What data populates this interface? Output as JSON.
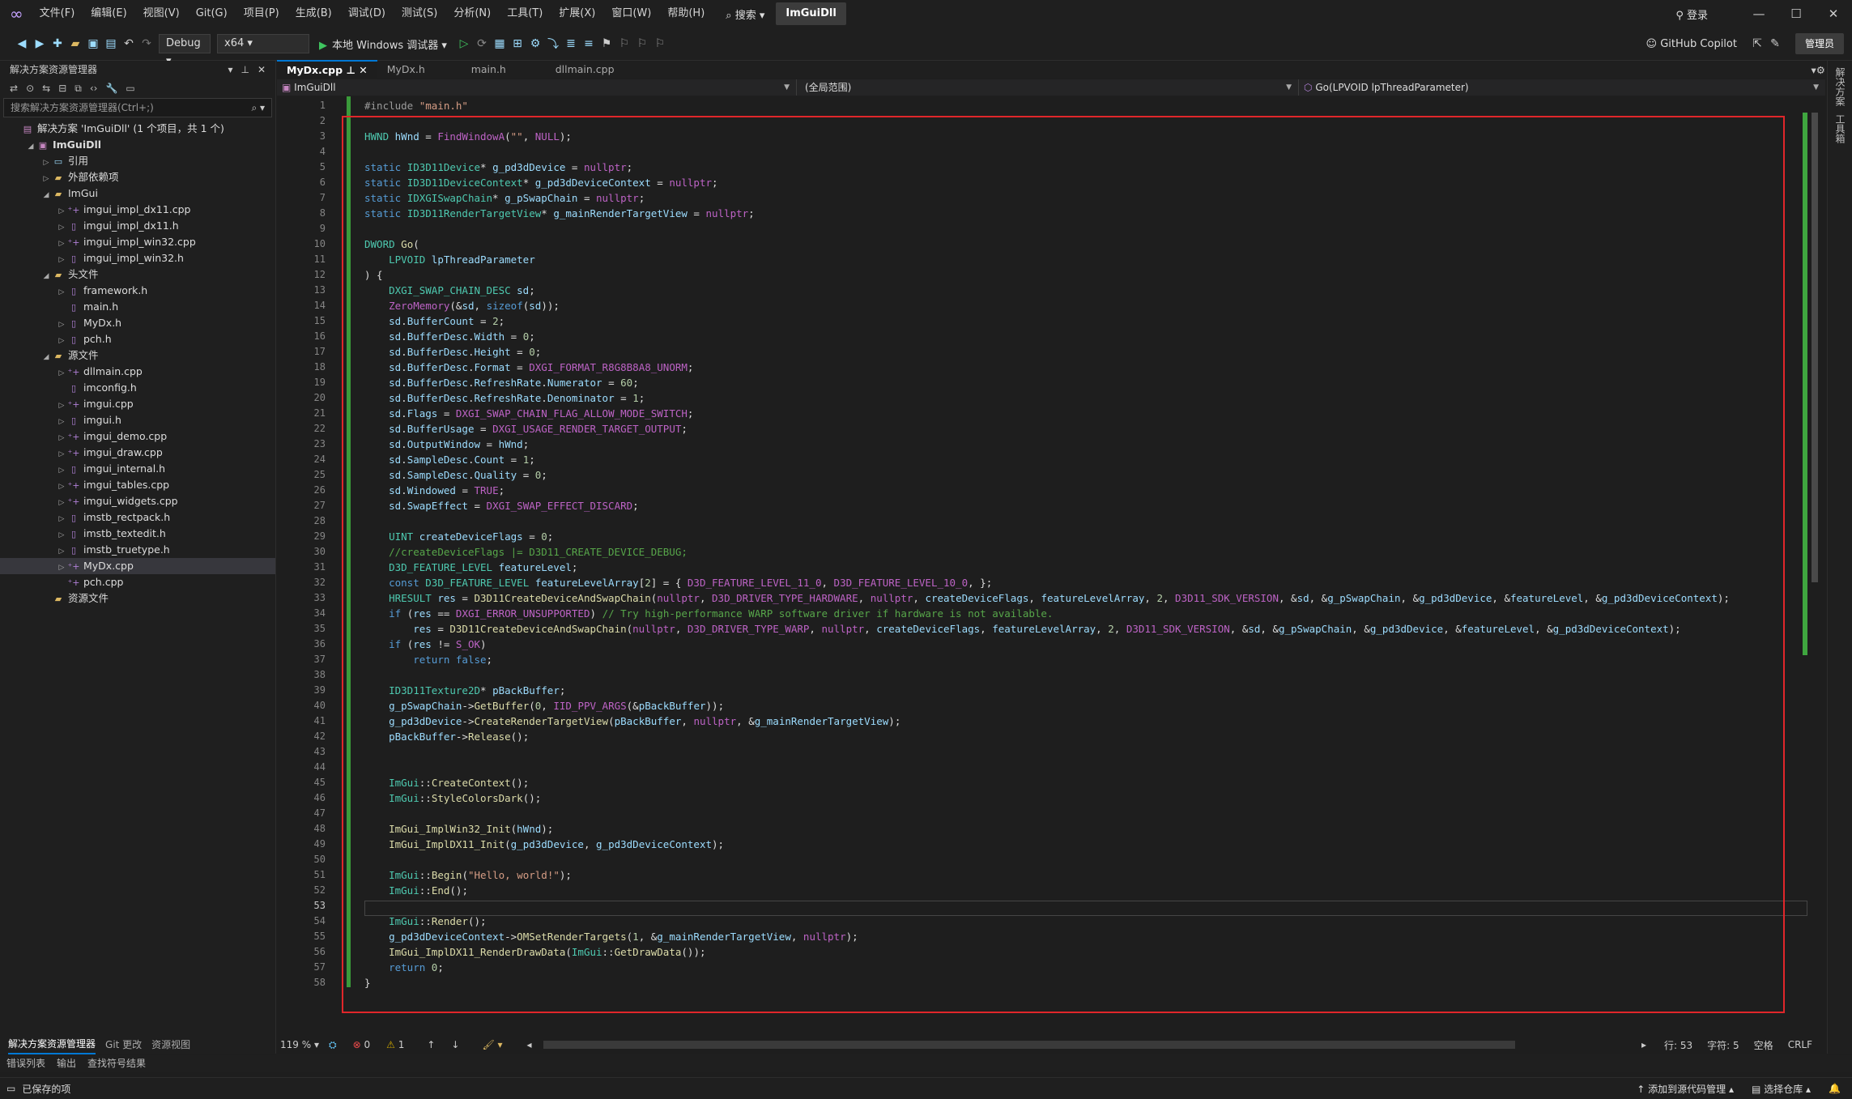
{
  "menubar": {
    "items": [
      "文件(F)",
      "编辑(E)",
      "视图(V)",
      "Git(G)",
      "项目(P)",
      "生成(B)",
      "调试(D)",
      "测试(S)",
      "分析(N)",
      "工具(T)",
      "扩展(X)",
      "窗口(W)",
      "帮助(H)"
    ],
    "search_label": "搜索",
    "app_title": "ImGuiDll",
    "login_label": "登录"
  },
  "toolbar": {
    "config": "Debug",
    "platform": "x64",
    "run_label": "本地 Windows 调试器",
    "copilot_label": "GitHub Copilot",
    "admin_label": "管理员"
  },
  "solution_explorer": {
    "title": "解决方案资源管理器",
    "search_placeholder": "搜索解决方案资源管理器(Ctrl+;)",
    "items": [
      {
        "label": "解决方案 'ImGuiDll' (1 个项目，共 1 个)",
        "indent": 0,
        "icon": "solution",
        "arrow": ""
      },
      {
        "label": "ImGuiDll",
        "indent": 1,
        "icon": "project",
        "arrow": "open",
        "bold": true
      },
      {
        "label": "引用",
        "indent": 2,
        "icon": "references",
        "arrow": "closed"
      },
      {
        "label": "外部依赖项",
        "indent": 2,
        "icon": "folder",
        "arrow": "closed"
      },
      {
        "label": "ImGui",
        "indent": 2,
        "icon": "folder",
        "arrow": "open"
      },
      {
        "label": "imgui_impl_dx11.cpp",
        "indent": 3,
        "icon": "cpp",
        "arrow": "closed"
      },
      {
        "label": "imgui_impl_dx11.h",
        "indent": 3,
        "icon": "h",
        "arrow": "closed"
      },
      {
        "label": "imgui_impl_win32.cpp",
        "indent": 3,
        "icon": "cpp",
        "arrow": "closed"
      },
      {
        "label": "imgui_impl_win32.h",
        "indent": 3,
        "icon": "h",
        "arrow": "closed"
      },
      {
        "label": "头文件",
        "indent": 2,
        "icon": "folder",
        "arrow": "open"
      },
      {
        "label": "framework.h",
        "indent": 3,
        "icon": "h",
        "arrow": "closed"
      },
      {
        "label": "main.h",
        "indent": 3,
        "icon": "h",
        "arrow": ""
      },
      {
        "label": "MyDx.h",
        "indent": 3,
        "icon": "h",
        "arrow": "closed"
      },
      {
        "label": "pch.h",
        "indent": 3,
        "icon": "h",
        "arrow": "closed"
      },
      {
        "label": "源文件",
        "indent": 2,
        "icon": "folder",
        "arrow": "open"
      },
      {
        "label": "dllmain.cpp",
        "indent": 3,
        "icon": "cpp",
        "arrow": "closed"
      },
      {
        "label": "imconfig.h",
        "indent": 3,
        "icon": "h",
        "arrow": ""
      },
      {
        "label": "imgui.cpp",
        "indent": 3,
        "icon": "cpp",
        "arrow": "closed"
      },
      {
        "label": "imgui.h",
        "indent": 3,
        "icon": "h",
        "arrow": "closed"
      },
      {
        "label": "imgui_demo.cpp",
        "indent": 3,
        "icon": "cpp",
        "arrow": "closed"
      },
      {
        "label": "imgui_draw.cpp",
        "indent": 3,
        "icon": "cpp",
        "arrow": "closed"
      },
      {
        "label": "imgui_internal.h",
        "indent": 3,
        "icon": "h",
        "arrow": "closed"
      },
      {
        "label": "imgui_tables.cpp",
        "indent": 3,
        "icon": "cpp",
        "arrow": "closed"
      },
      {
        "label": "imgui_widgets.cpp",
        "indent": 3,
        "icon": "cpp",
        "arrow": "closed"
      },
      {
        "label": "imstb_rectpack.h",
        "indent": 3,
        "icon": "h",
        "arrow": "closed"
      },
      {
        "label": "imstb_textedit.h",
        "indent": 3,
        "icon": "h",
        "arrow": "closed"
      },
      {
        "label": "imstb_truetype.h",
        "indent": 3,
        "icon": "h",
        "arrow": "closed"
      },
      {
        "label": "MyDx.cpp",
        "indent": 3,
        "icon": "cpp",
        "arrow": "closed",
        "selected": true
      },
      {
        "label": "pch.cpp",
        "indent": 3,
        "icon": "cpp",
        "arrow": ""
      },
      {
        "label": "资源文件",
        "indent": 2,
        "icon": "folder",
        "arrow": ""
      }
    ],
    "tabs": [
      "解决方案资源管理器",
      "Git 更改",
      "资源视图"
    ]
  },
  "editor": {
    "tabs": [
      "MyDx.cpp",
      "MyDx.h",
      "main.h",
      "dllmain.cpp"
    ],
    "nav_project": "ImGuiDll",
    "nav_scope": "(全局范围)",
    "nav_function": "Go(LPVOID lpThreadParameter)",
    "current_line": 53,
    "lines": [
      "#include \"main.h\"",
      "",
      "HWND hWnd = FindWindowA(\"\", NULL);",
      "",
      "static ID3D11Device* g_pd3dDevice = nullptr;",
      "static ID3D11DeviceContext* g_pd3dDeviceContext = nullptr;",
      "static IDXGISwapChain* g_pSwapChain = nullptr;",
      "static ID3D11RenderTargetView* g_mainRenderTargetView = nullptr;",
      "",
      "DWORD Go(",
      "    LPVOID lpThreadParameter",
      ") {",
      "    DXGI_SWAP_CHAIN_DESC sd;",
      "    ZeroMemory(&sd, sizeof(sd));",
      "    sd.BufferCount = 2;",
      "    sd.BufferDesc.Width = 0;",
      "    sd.BufferDesc.Height = 0;",
      "    sd.BufferDesc.Format = DXGI_FORMAT_R8G8B8A8_UNORM;",
      "    sd.BufferDesc.RefreshRate.Numerator = 60;",
      "    sd.BufferDesc.RefreshRate.Denominator = 1;",
      "    sd.Flags = DXGI_SWAP_CHAIN_FLAG_ALLOW_MODE_SWITCH;",
      "    sd.BufferUsage = DXGI_USAGE_RENDER_TARGET_OUTPUT;",
      "    sd.OutputWindow = hWnd;",
      "    sd.SampleDesc.Count = 1;",
      "    sd.SampleDesc.Quality = 0;",
      "    sd.Windowed = TRUE;",
      "    sd.SwapEffect = DXGI_SWAP_EFFECT_DISCARD;",
      "",
      "    UINT createDeviceFlags = 0;",
      "    //createDeviceFlags |= D3D11_CREATE_DEVICE_DEBUG;",
      "    D3D_FEATURE_LEVEL featureLevel;",
      "    const D3D_FEATURE_LEVEL featureLevelArray[2] = { D3D_FEATURE_LEVEL_11_0, D3D_FEATURE_LEVEL_10_0, };",
      "    HRESULT res = D3D11CreateDeviceAndSwapChain(nullptr, D3D_DRIVER_TYPE_HARDWARE, nullptr, createDeviceFlags, featureLevelArray, 2, D3D11_SDK_VERSION, &sd, &g_pSwapChain, &g_pd3dDevice, &featureLevel, &g_pd3dDeviceContext);",
      "    if (res == DXGI_ERROR_UNSUPPORTED) // Try high-performance WARP software driver if hardware is not available.",
      "        res = D3D11CreateDeviceAndSwapChain(nullptr, D3D_DRIVER_TYPE_WARP, nullptr, createDeviceFlags, featureLevelArray, 2, D3D11_SDK_VERSION, &sd, &g_pSwapChain, &g_pd3dDevice, &featureLevel, &g_pd3dDeviceContext);",
      "    if (res != S_OK)",
      "        return false;",
      "",
      "    ID3D11Texture2D* pBackBuffer;",
      "    g_pSwapChain->GetBuffer(0, IID_PPV_ARGS(&pBackBuffer));",
      "    g_pd3dDevice->CreateRenderTargetView(pBackBuffer, nullptr, &g_mainRenderTargetView);",
      "    pBackBuffer->Release();",
      "",
      "",
      "    ImGui::CreateContext();",
      "    ImGui::StyleColorsDark();",
      "",
      "    ImGui_ImplWin32_Init(hWnd);",
      "    ImGui_ImplDX11_Init(g_pd3dDevice, g_pd3dDeviceContext);",
      "",
      "    ImGui::Begin(\"Hello, world!\");",
      "    ImGui::End();",
      "",
      "    ImGui::Render();",
      "    g_pd3dDeviceContext->OMSetRenderTargets(1, &g_mainRenderTargetView, nullptr);",
      "    ImGui_ImplDX11_RenderDrawData(ImGui::GetDrawData());",
      "    return 0;",
      "}"
    ],
    "zoom": "119 %",
    "errors": "0",
    "warnings": "1",
    "position_row": "行: 53",
    "position_col": "字符: 5",
    "whitespace": "空格",
    "line_ending": "CRLF"
  },
  "bottom_tabs": [
    "错误列表",
    "输出",
    "查找符号结果"
  ],
  "status": {
    "ready": "已保存的项",
    "add_source_control": "添加到源代码管理",
    "select_repo": "选择仓库"
  },
  "right_strip": [
    "解决方案",
    "工具箱"
  ]
}
